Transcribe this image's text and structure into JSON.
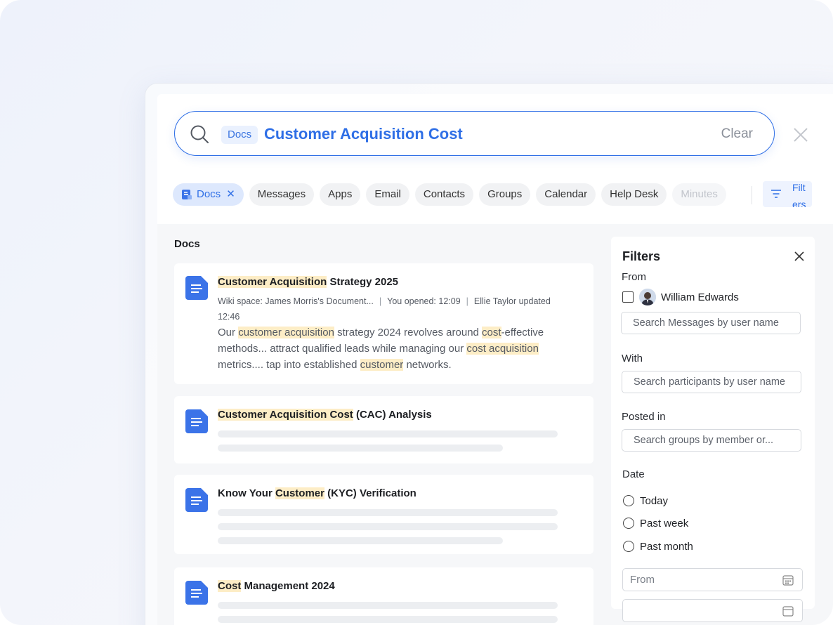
{
  "search": {
    "scope": "Docs",
    "query": "Customer Acquisition Cost",
    "clear_label": "Clear"
  },
  "tabs": [
    {
      "label": "Docs",
      "active": true
    },
    {
      "label": "Messages"
    },
    {
      "label": "Apps"
    },
    {
      "label": "Email"
    },
    {
      "label": "Contacts"
    },
    {
      "label": "Groups"
    },
    {
      "label": "Calendar"
    },
    {
      "label": "Help Desk"
    },
    {
      "label": "Minutes"
    }
  ],
  "tab_close_glyph": "✕",
  "filters_toggle_label": "Filters",
  "results": {
    "section_title": "Docs",
    "items": [
      {
        "title_parts": [
          {
            "t": "Customer Acquisition",
            "hl": true
          },
          {
            "t": " Strategy 2025"
          }
        ],
        "meta": {
          "space": "Wiki space: James Morris's Document...",
          "opened": "You opened: 12:09",
          "updated": "Ellie Taylor updated",
          "updated_time": "12:46"
        },
        "snippet_parts": [
          {
            "t": "Our "
          },
          {
            "t": "customer acquisition",
            "hl": true
          },
          {
            "t": " strategy 2024 revolves around "
          },
          {
            "t": "cost",
            "hl": true
          },
          {
            "t": "-effective methods... attract qualified leads while managing our "
          },
          {
            "t": "cost acquisition",
            "hl": true
          },
          {
            "t": " metrics.... tap into established "
          },
          {
            "t": "customer",
            "hl": true
          },
          {
            "t": " networks."
          }
        ]
      },
      {
        "title_parts": [
          {
            "t": "Customer Acquisition Cost",
            "hl": true
          },
          {
            "t": " (CAC) Analysis"
          }
        ]
      },
      {
        "title_parts": [
          {
            "t": "Know Your "
          },
          {
            "t": "Customer",
            "hl": true
          },
          {
            "t": " (KYC) Verification"
          }
        ]
      },
      {
        "title_parts": [
          {
            "t": "Cost",
            "hl": true
          },
          {
            "t": " Management 2024"
          }
        ]
      }
    ]
  },
  "filters": {
    "title": "Filters",
    "from_label": "From",
    "from_user": "William Edwards",
    "from_placeholder": "Search Messages by user name",
    "with_label": "With",
    "with_placeholder": "Search participants by user name",
    "posted_label": "Posted in",
    "posted_placeholder": "Search groups by member or...",
    "date_label": "Date",
    "date_options": [
      "Today",
      "Past week",
      "Past month"
    ],
    "date_from_placeholder": "From"
  },
  "colors": {
    "accent": "#2f6fe6",
    "highlight": "#fdedc6",
    "doc_icon": "#3b73e8"
  }
}
